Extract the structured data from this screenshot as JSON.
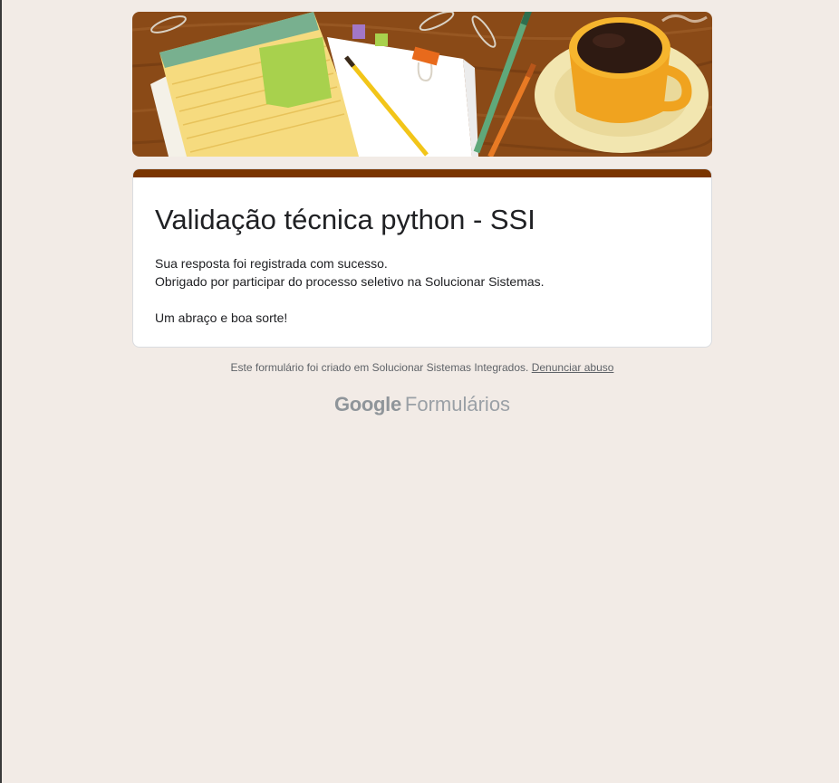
{
  "form": {
    "title": "Validação técnica python - SSI",
    "confirmation_lines": [
      "Sua resposta foi registrada com sucesso.",
      "Obrigado por participar do processo seletivo na Solucionar Sistemas.",
      "Um abraço e boa sorte!"
    ]
  },
  "footer": {
    "created_text": "Este formulário foi criado em Solucionar Sistemas Integrados.",
    "report_link": "Denunciar abuso"
  },
  "branding": {
    "google": "Google",
    "product": "Formulários"
  },
  "theme": {
    "background": "#f2ebe6",
    "accent": "#7a3500",
    "card": "#ffffff"
  }
}
